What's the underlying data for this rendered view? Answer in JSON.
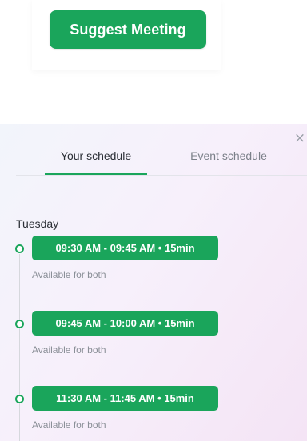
{
  "suggest_button": {
    "label": "Suggest Meeting"
  },
  "schedule": {
    "tabs": [
      {
        "label": "Your schedule",
        "active": true
      },
      {
        "label": "Event schedule",
        "active": false
      }
    ],
    "close_icon": "×",
    "day": "Tuesday",
    "slots": [
      {
        "time": "09:30 AM - 09:45 AM • 15min",
        "caption": "Available for both"
      },
      {
        "time": "09:45 AM - 10:00 AM • 15min",
        "caption": "Available for both"
      },
      {
        "time": "11:30 AM - 11:45 AM • 15min",
        "caption": "Available for both"
      }
    ]
  },
  "colors": {
    "accent_green": "#1aa55b",
    "text_primary": "#2b2f36",
    "text_secondary": "#8a8f97"
  }
}
